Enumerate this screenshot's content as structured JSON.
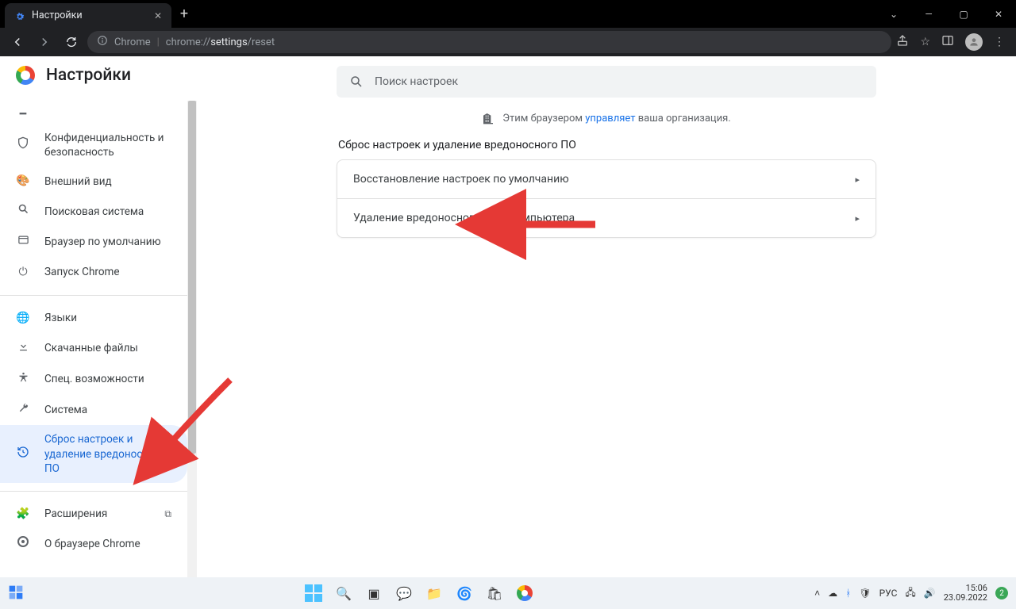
{
  "window": {
    "tab_title": "Настройки",
    "url_scheme": "Chrome",
    "url_path_dim": "chrome://",
    "url_path_mid": "settings",
    "url_path_tail": "/reset"
  },
  "settings": {
    "title": "Настройки",
    "search_placeholder": "Поиск настроек",
    "managed_prefix": "Этим браузером",
    "managed_link": "управляет",
    "managed_suffix": "ваша организация.",
    "section_title": "Сброс настроек и удаление вредоносного ПО",
    "rows": [
      "Восстановление настроек по умолчанию",
      "Удаление вредоносного ПО с компьютера"
    ]
  },
  "sidebar": {
    "items": [
      {
        "icon": "🛡",
        "label": "Конфиденциальность и безопасность"
      },
      {
        "icon": "🎨",
        "label": "Внешний вид"
      },
      {
        "icon": "🔍",
        "label": "Поисковая система"
      },
      {
        "icon": "▭",
        "label": "Браузер по умолчанию"
      },
      {
        "icon": "⏻",
        "label": "Запуск Chrome"
      }
    ],
    "items2": [
      {
        "icon": "🌐",
        "label": "Языки"
      },
      {
        "icon": "⬇",
        "label": "Скачанные файлы"
      },
      {
        "icon": "♿",
        "label": "Спец. возможности"
      },
      {
        "icon": "🔧",
        "label": "Система"
      },
      {
        "icon": "↺",
        "label": "Сброс настроек и удаление вредоносного ПО"
      }
    ],
    "items3": [
      {
        "icon": "🧩",
        "label": "Расширения"
      },
      {
        "icon": "◎",
        "label": "О браузере Chrome"
      }
    ]
  },
  "taskbar": {
    "lang": "РУС",
    "time": "15:06",
    "date": "23.09.2022",
    "badge": "2"
  }
}
